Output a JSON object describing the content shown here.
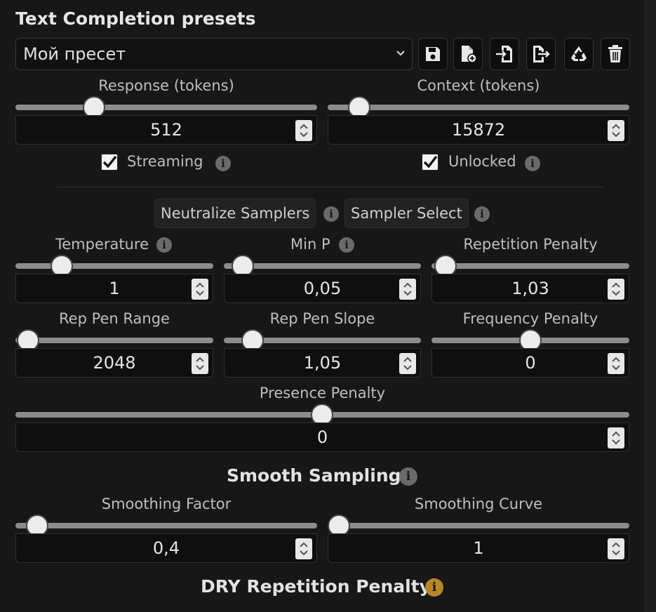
{
  "header": {
    "title": "Text Completion presets"
  },
  "preset": {
    "selected": "Мой пресет"
  },
  "toolbar": {
    "icons": [
      "save-icon",
      "new-file-icon",
      "import-icon",
      "export-icon",
      "recycle-icon",
      "trash-icon"
    ]
  },
  "main": {
    "response": {
      "label": "Response (tokens)",
      "value": "512"
    },
    "context": {
      "label": "Context (tokens)",
      "value": "15872"
    },
    "streaming": {
      "label": "Streaming",
      "checked": true
    },
    "unlocked": {
      "label": "Unlocked",
      "checked": true
    },
    "neutralize": {
      "label": "Neutralize Samplers"
    },
    "sampler_select": {
      "label": "Sampler Select"
    },
    "temperature": {
      "label": "Temperature",
      "value": "1"
    },
    "min_p": {
      "label": "Min P",
      "value": "0,05"
    },
    "rep_penalty": {
      "label": "Repetition Penalty",
      "value": "1,03"
    },
    "rep_pen_range": {
      "label": "Rep Pen Range",
      "value": "2048"
    },
    "rep_pen_slope": {
      "label": "Rep Pen Slope",
      "value": "1,05"
    },
    "freq_penalty": {
      "label": "Frequency Penalty",
      "value": "0"
    },
    "presence_penalty": {
      "label": "Presence Penalty",
      "value": "0"
    },
    "smooth_sampling": {
      "title": "Smooth Sampling"
    },
    "smoothing_factor": {
      "label": "Smoothing Factor",
      "value": "0,4"
    },
    "smoothing_curve": {
      "label": "Smoothing Curve",
      "value": "1"
    },
    "dry": {
      "title": "DRY Repetition Penalty"
    }
  },
  "colors": {
    "accent_info": "#b5862a",
    "background": "#171717"
  }
}
